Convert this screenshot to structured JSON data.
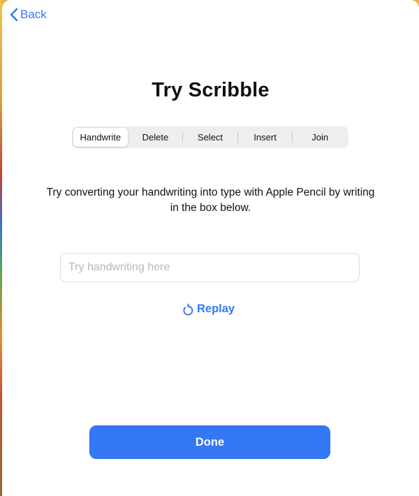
{
  "nav": {
    "back_label": "Back",
    "back_icon": "chevron-left-icon"
  },
  "title": "Try Scribble",
  "segments": {
    "items": [
      "Handwrite",
      "Delete",
      "Select",
      "Insert",
      "Join"
    ],
    "selected": "Handwrite"
  },
  "instructions": "Try converting your handwriting into type with Apple Pencil by writing in the box below.",
  "handwriting_field": {
    "placeholder": "Try handwriting here",
    "value": ""
  },
  "replay": {
    "label": "Replay",
    "icon": "replay-arrow-icon"
  },
  "done_label": "Done",
  "colors": {
    "accent": "#3478f6",
    "background": "#ffffff",
    "segment_background": "#eeeeef"
  }
}
